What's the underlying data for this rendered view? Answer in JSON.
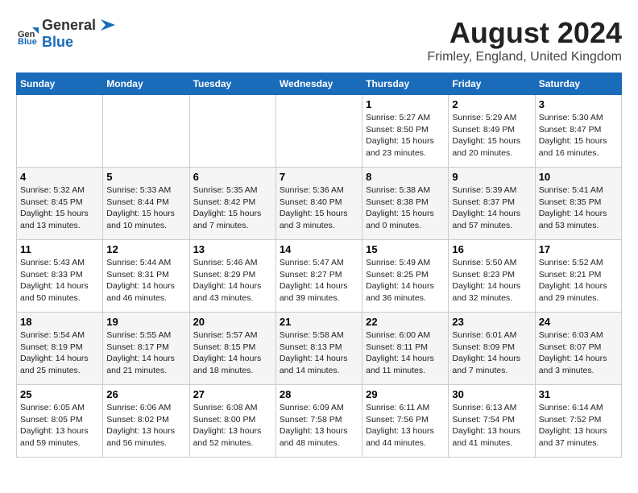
{
  "header": {
    "logo_general": "General",
    "logo_blue": "Blue",
    "title": "August 2024",
    "subtitle": "Frimley, England, United Kingdom"
  },
  "days_of_week": [
    "Sunday",
    "Monday",
    "Tuesday",
    "Wednesday",
    "Thursday",
    "Friday",
    "Saturday"
  ],
  "weeks": [
    [
      {
        "day": "",
        "info": ""
      },
      {
        "day": "",
        "info": ""
      },
      {
        "day": "",
        "info": ""
      },
      {
        "day": "",
        "info": ""
      },
      {
        "day": "1",
        "info": "Sunrise: 5:27 AM\nSunset: 8:50 PM\nDaylight: 15 hours\nand 23 minutes."
      },
      {
        "day": "2",
        "info": "Sunrise: 5:29 AM\nSunset: 8:49 PM\nDaylight: 15 hours\nand 20 minutes."
      },
      {
        "day": "3",
        "info": "Sunrise: 5:30 AM\nSunset: 8:47 PM\nDaylight: 15 hours\nand 16 minutes."
      }
    ],
    [
      {
        "day": "4",
        "info": "Sunrise: 5:32 AM\nSunset: 8:45 PM\nDaylight: 15 hours\nand 13 minutes."
      },
      {
        "day": "5",
        "info": "Sunrise: 5:33 AM\nSunset: 8:44 PM\nDaylight: 15 hours\nand 10 minutes."
      },
      {
        "day": "6",
        "info": "Sunrise: 5:35 AM\nSunset: 8:42 PM\nDaylight: 15 hours\nand 7 minutes."
      },
      {
        "day": "7",
        "info": "Sunrise: 5:36 AM\nSunset: 8:40 PM\nDaylight: 15 hours\nand 3 minutes."
      },
      {
        "day": "8",
        "info": "Sunrise: 5:38 AM\nSunset: 8:38 PM\nDaylight: 15 hours\nand 0 minutes."
      },
      {
        "day": "9",
        "info": "Sunrise: 5:39 AM\nSunset: 8:37 PM\nDaylight: 14 hours\nand 57 minutes."
      },
      {
        "day": "10",
        "info": "Sunrise: 5:41 AM\nSunset: 8:35 PM\nDaylight: 14 hours\nand 53 minutes."
      }
    ],
    [
      {
        "day": "11",
        "info": "Sunrise: 5:43 AM\nSunset: 8:33 PM\nDaylight: 14 hours\nand 50 minutes."
      },
      {
        "day": "12",
        "info": "Sunrise: 5:44 AM\nSunset: 8:31 PM\nDaylight: 14 hours\nand 46 minutes."
      },
      {
        "day": "13",
        "info": "Sunrise: 5:46 AM\nSunset: 8:29 PM\nDaylight: 14 hours\nand 43 minutes."
      },
      {
        "day": "14",
        "info": "Sunrise: 5:47 AM\nSunset: 8:27 PM\nDaylight: 14 hours\nand 39 minutes."
      },
      {
        "day": "15",
        "info": "Sunrise: 5:49 AM\nSunset: 8:25 PM\nDaylight: 14 hours\nand 36 minutes."
      },
      {
        "day": "16",
        "info": "Sunrise: 5:50 AM\nSunset: 8:23 PM\nDaylight: 14 hours\nand 32 minutes."
      },
      {
        "day": "17",
        "info": "Sunrise: 5:52 AM\nSunset: 8:21 PM\nDaylight: 14 hours\nand 29 minutes."
      }
    ],
    [
      {
        "day": "18",
        "info": "Sunrise: 5:54 AM\nSunset: 8:19 PM\nDaylight: 14 hours\nand 25 minutes."
      },
      {
        "day": "19",
        "info": "Sunrise: 5:55 AM\nSunset: 8:17 PM\nDaylight: 14 hours\nand 21 minutes."
      },
      {
        "day": "20",
        "info": "Sunrise: 5:57 AM\nSunset: 8:15 PM\nDaylight: 14 hours\nand 18 minutes."
      },
      {
        "day": "21",
        "info": "Sunrise: 5:58 AM\nSunset: 8:13 PM\nDaylight: 14 hours\nand 14 minutes."
      },
      {
        "day": "22",
        "info": "Sunrise: 6:00 AM\nSunset: 8:11 PM\nDaylight: 14 hours\nand 11 minutes."
      },
      {
        "day": "23",
        "info": "Sunrise: 6:01 AM\nSunset: 8:09 PM\nDaylight: 14 hours\nand 7 minutes."
      },
      {
        "day": "24",
        "info": "Sunrise: 6:03 AM\nSunset: 8:07 PM\nDaylight: 14 hours\nand 3 minutes."
      }
    ],
    [
      {
        "day": "25",
        "info": "Sunrise: 6:05 AM\nSunset: 8:05 PM\nDaylight: 13 hours\nand 59 minutes."
      },
      {
        "day": "26",
        "info": "Sunrise: 6:06 AM\nSunset: 8:02 PM\nDaylight: 13 hours\nand 56 minutes."
      },
      {
        "day": "27",
        "info": "Sunrise: 6:08 AM\nSunset: 8:00 PM\nDaylight: 13 hours\nand 52 minutes."
      },
      {
        "day": "28",
        "info": "Sunrise: 6:09 AM\nSunset: 7:58 PM\nDaylight: 13 hours\nand 48 minutes."
      },
      {
        "day": "29",
        "info": "Sunrise: 6:11 AM\nSunset: 7:56 PM\nDaylight: 13 hours\nand 44 minutes."
      },
      {
        "day": "30",
        "info": "Sunrise: 6:13 AM\nSunset: 7:54 PM\nDaylight: 13 hours\nand 41 minutes."
      },
      {
        "day": "31",
        "info": "Sunrise: 6:14 AM\nSunset: 7:52 PM\nDaylight: 13 hours\nand 37 minutes."
      }
    ]
  ]
}
